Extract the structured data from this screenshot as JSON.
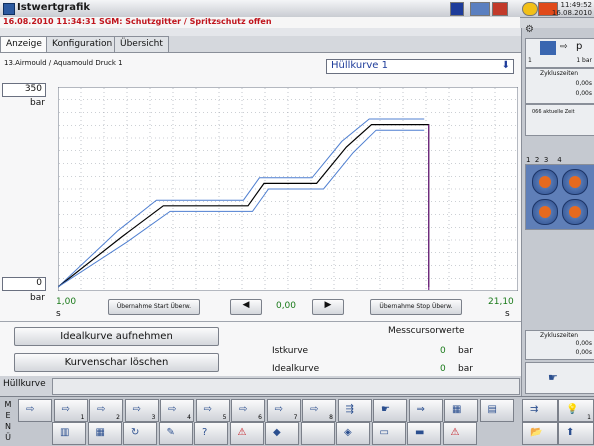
{
  "window": {
    "title": "Istwertgrafik"
  },
  "status": {
    "message": "16.08.2010 11:34:31  SGM: Schutzgitter / Spritzschutz offen",
    "time": "11:49:52",
    "date": "16.08.2010"
  },
  "tabs": [
    {
      "label": "Anzeige"
    },
    {
      "label": "Konfiguration"
    },
    {
      "label": "Übersicht"
    }
  ],
  "curve": {
    "name": "13.Airmould / Aquamould Druck 1",
    "dropdown_value": "Hüllkurve 1"
  },
  "chart_data": {
    "type": "line",
    "ylim": [
      0,
      350
    ],
    "y_top_label": "350",
    "y_bottom_label": "0",
    "y_unit": "bar",
    "x_start": "1,00",
    "x_end": "21,10",
    "x_unit": "s",
    "xlim": [
      1.0,
      21.1
    ],
    "colors": {
      "actual": "#000000",
      "envelope": "#4f7fd0",
      "ideal": "#7a2a8a"
    },
    "series": [
      {
        "key": "upper",
        "x": [
          1.0,
          3.6,
          5.3,
          6.0,
          9.1,
          9.8,
          11.5,
          12.1,
          13.4,
          14.6,
          17.0
        ],
        "y": [
          0,
          100,
          155,
          155,
          155,
          195,
          195,
          195,
          260,
          300,
          300
        ]
      },
      {
        "key": "actual",
        "x": [
          1.0,
          3.8,
          5.6,
          6.2,
          9.3,
          10.0,
          11.7,
          12.3,
          13.6,
          14.7,
          17.2,
          17.2
        ],
        "y": [
          0,
          90,
          145,
          145,
          145,
          185,
          185,
          185,
          250,
          290,
          290,
          0
        ]
      },
      {
        "key": "lower",
        "x": [
          1.0,
          4.0,
          5.9,
          6.5,
          9.5,
          10.2,
          12.0,
          12.6,
          13.9,
          14.9,
          17.0
        ],
        "y": [
          0,
          80,
          135,
          135,
          135,
          175,
          175,
          175,
          240,
          280,
          280
        ]
      }
    ]
  },
  "controls": {
    "start_button": "Übernahme Start Überw.",
    "stop_button": "Übernahme Stop Überw.",
    "cursor_value": "0,00",
    "ideal_record": "Idealkurve aufnehmen",
    "clear_family": "Kurvenschar löschen"
  },
  "cursor_values": {
    "title": "Messcursorwerte",
    "actual_label": "Istkurve",
    "actual_value": "0",
    "ideal_label": "Idealkurve",
    "ideal_value": "0",
    "unit": "bar"
  },
  "footer": {
    "label": "Hüllkurve"
  },
  "sidebar": {
    "mode_value": "1",
    "mode_unit": "1 bar",
    "cycle_label": "Zykluszeiten",
    "cycle_value1": "0,00s",
    "cycle_value2": "0,00s",
    "current_time": "066 aktuelle Zeit",
    "numbers": [
      "1",
      "2",
      "3",
      "4"
    ],
    "cycle_label2": "Zykluszeiten",
    "cycle2_value1": "0,00s",
    "cycle2_value2": "0,00s",
    "p_label": "p"
  },
  "menu_letters": [
    "M",
    "E",
    "N",
    "Ü"
  ],
  "toolbar_row1": [
    {
      "icon": "inject-icon",
      "sub": ""
    },
    {
      "icon": "inject-icon",
      "sub": "1"
    },
    {
      "icon": "inject-icon",
      "sub": "2"
    },
    {
      "icon": "inject-icon",
      "sub": "3"
    },
    {
      "icon": "inject-icon",
      "sub": "4"
    },
    {
      "icon": "inject-icon",
      "sub": "5"
    },
    {
      "icon": "inject-icon",
      "sub": "6"
    },
    {
      "icon": "inject-icon",
      "sub": "7"
    },
    {
      "icon": "inject-icon",
      "sub": "8"
    },
    {
      "icon": "ejector-icon",
      "sub": ""
    },
    {
      "icon": "robot-icon",
      "sub": ""
    },
    {
      "icon": "sequence-icon",
      "sub": ""
    },
    {
      "icon": "machine-icon",
      "sub": ""
    },
    {
      "icon": "panel-icon",
      "sub": ""
    }
  ],
  "toolbar_row2": [
    {
      "icon": "mold-icon"
    },
    {
      "icon": "table-icon"
    },
    {
      "icon": "cycle-icon"
    },
    {
      "icon": "wrench-icon"
    },
    {
      "icon": "help-icon"
    },
    {
      "icon": "alarm-icon"
    },
    {
      "icon": "diamond-icon"
    },
    {
      "icon": "blank-icon"
    },
    {
      "icon": "target-icon"
    },
    {
      "icon": "computer-icon"
    },
    {
      "icon": "printer-icon"
    },
    {
      "icon": "warning-icon"
    }
  ]
}
